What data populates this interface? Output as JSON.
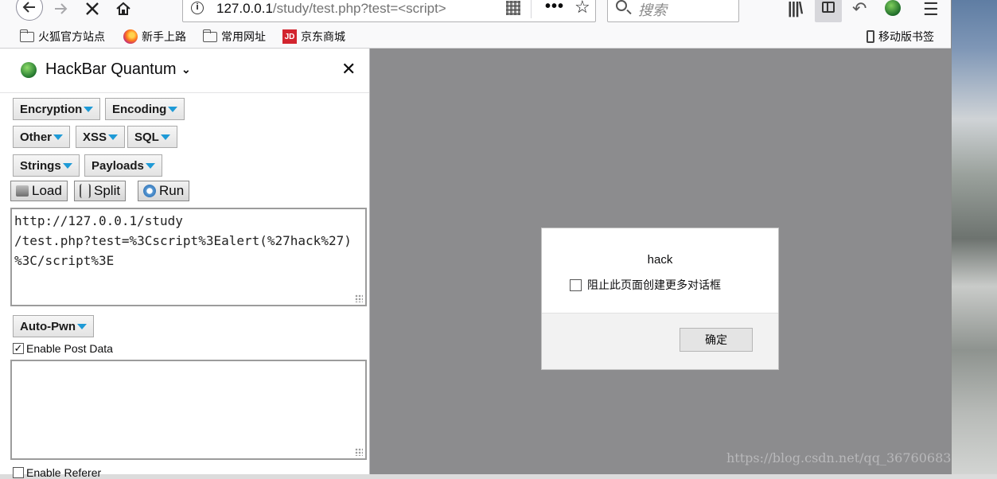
{
  "toolbar": {
    "url_host": "127.0.0.1",
    "url_path": "/study/test.php?test=<script>",
    "search_placeholder": "搜索"
  },
  "bookmarks": [
    {
      "label": "火狐官方站点",
      "icon": "folder-icon"
    },
    {
      "label": "新手上路",
      "icon": "firefox-icon"
    },
    {
      "label": "常用网址",
      "icon": "folder-icon"
    },
    {
      "label": "京东商城",
      "icon": "jd-icon"
    }
  ],
  "mobile_bookmarks": "移动版书签",
  "hackbar": {
    "title": "HackBar Quantum",
    "dropdowns_row1": [
      "Encryption",
      "Encoding"
    ],
    "dropdowns_row2": [
      "Other",
      "XSS",
      "SQL"
    ],
    "dropdowns_row3": [
      "Strings",
      "Payloads"
    ],
    "actions": [
      "Load",
      "Split",
      "Run"
    ],
    "url_value": "http://127.0.0.1/study\n/test.php?test=%3Cscript%3Ealert(%27hack%27)\n%3C/script%3E",
    "autopwn": "Auto-Pwn",
    "enable_post": "Enable Post Data",
    "enable_post_checked": true,
    "enable_referer": "Enable Referer"
  },
  "dialog": {
    "message": "hack",
    "checkbox_label": "阻止此页面创建更多对话框",
    "ok_label": "确定"
  },
  "watermark": "https://blog.csdn.net/qq_36760683",
  "colors": {
    "dropdown_arrow": "#1e9ad6",
    "content_overlay": "#8c8c8e"
  }
}
